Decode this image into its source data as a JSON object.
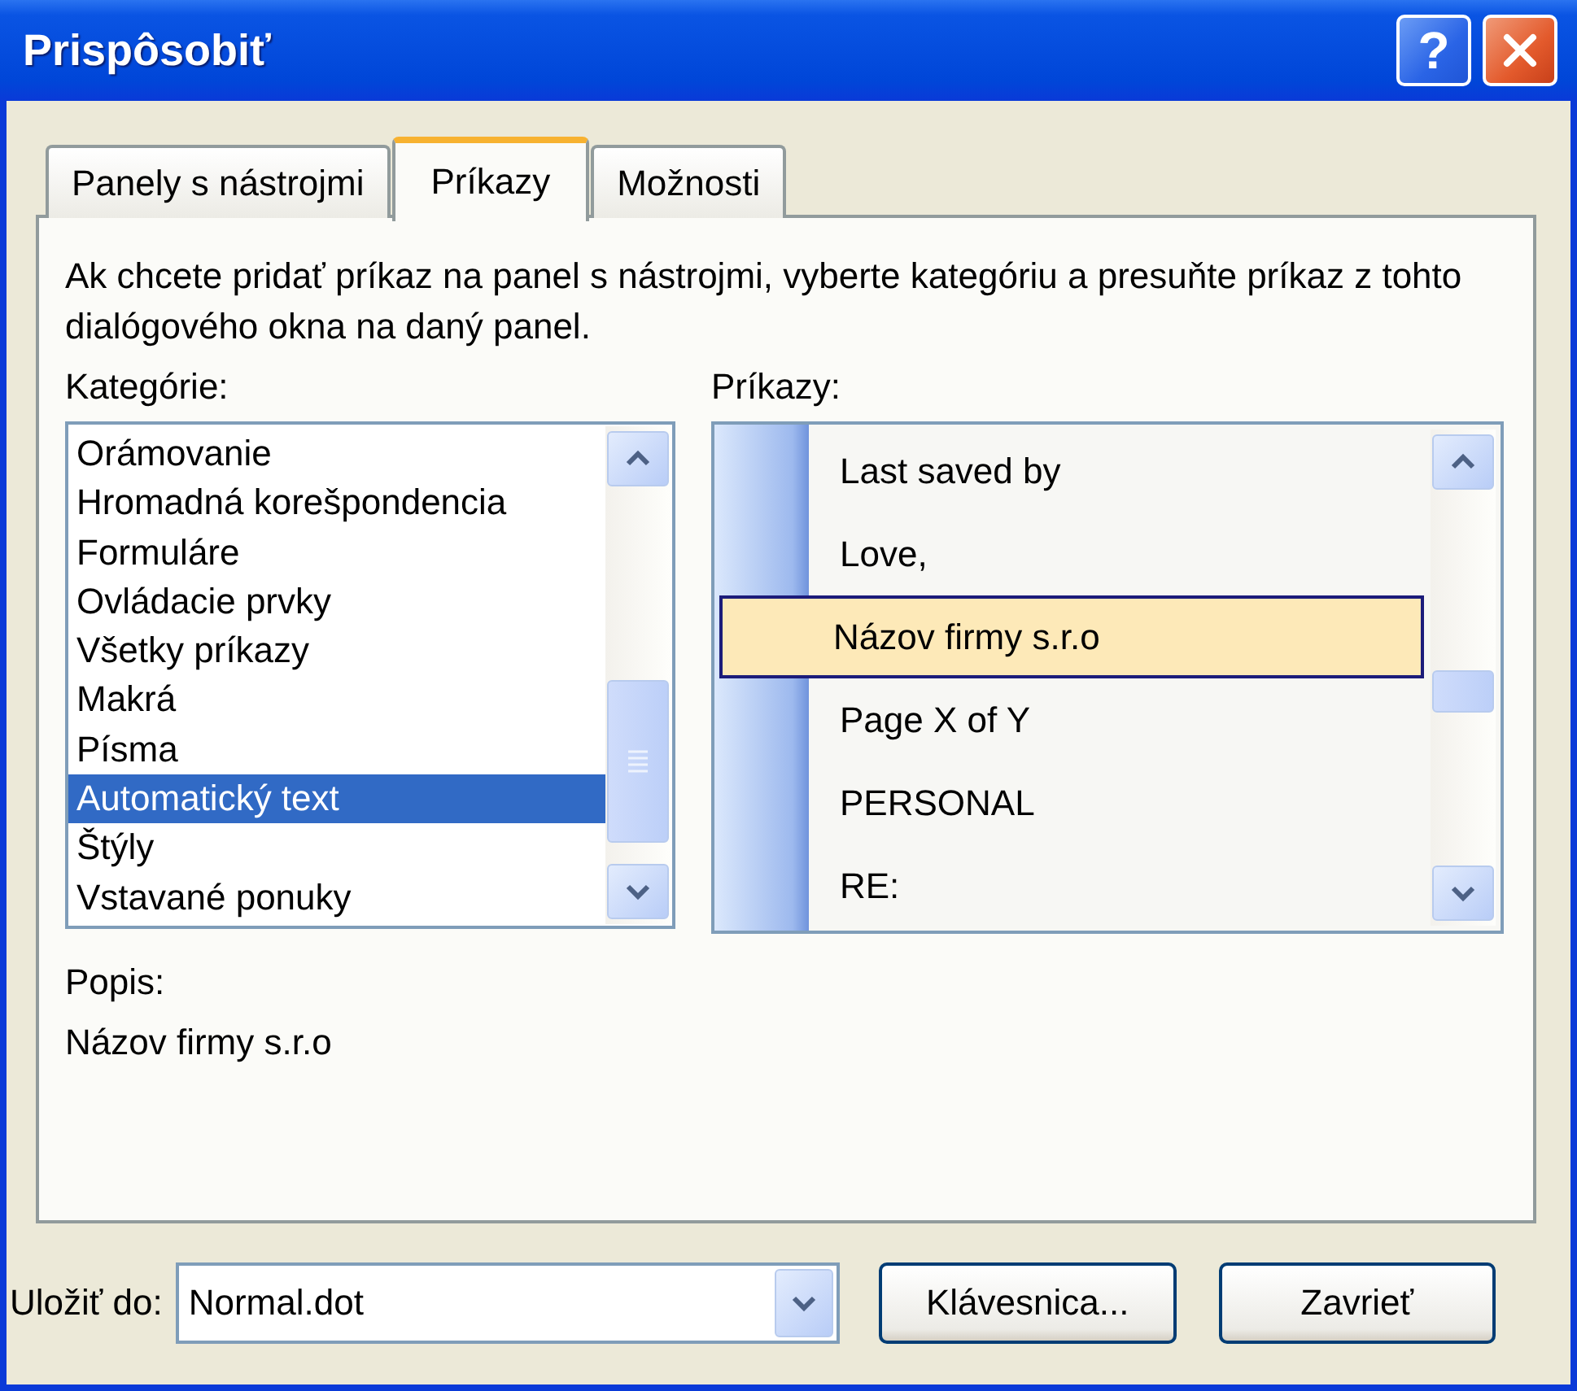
{
  "window": {
    "title": "Prispôsobiť",
    "help_label": "?"
  },
  "tabs": [
    {
      "label": "Panely s nástrojmi",
      "selected": false
    },
    {
      "label": "Príkazy",
      "selected": true
    },
    {
      "label": "Možnosti",
      "selected": false
    }
  ],
  "instructions": "Ak chcete pridať príkaz na panel s nástrojmi, vyberte kategóriu a presuňte príkaz z tohto dialógového okna na daný panel.",
  "categories": {
    "label": "Kategórie:",
    "items": [
      {
        "label": "Orámovanie",
        "selected": false
      },
      {
        "label": "Hromadná korešpondencia",
        "selected": false
      },
      {
        "label": "Formuláre",
        "selected": false
      },
      {
        "label": "Ovládacie prvky",
        "selected": false
      },
      {
        "label": "Všetky príkazy",
        "selected": false
      },
      {
        "label": "Makrá",
        "selected": false
      },
      {
        "label": "Písma",
        "selected": false
      },
      {
        "label": "Automatický text",
        "selected": true
      },
      {
        "label": "Štýly",
        "selected": false
      },
      {
        "label": "Vstavané ponuky",
        "selected": false
      }
    ]
  },
  "commands": {
    "label": "Príkazy:",
    "items": [
      {
        "label": "Last saved by",
        "selected": false
      },
      {
        "label": "Love,",
        "selected": false
      },
      {
        "label": "Názov firmy s.r.o",
        "selected": true
      },
      {
        "label": "Page X of Y",
        "selected": false
      },
      {
        "label": "PERSONAL",
        "selected": false
      },
      {
        "label": "RE:",
        "selected": false
      }
    ]
  },
  "description": {
    "label": "Popis:",
    "value": "Názov firmy s.r.o"
  },
  "save_in": {
    "label": "Uložiť do:",
    "value": "Normal.dot"
  },
  "buttons": [
    {
      "label": "Klávesnica..."
    },
    {
      "label": "Zavrieť"
    }
  ]
}
